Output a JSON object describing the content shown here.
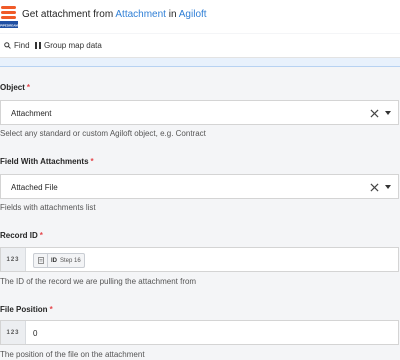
{
  "header": {
    "logo_text": "PIPEDREAM",
    "title_prefix": "Get attachment from ",
    "title_link_1": "Attachment",
    "title_mid": " in ",
    "title_link_2": "Agiloft"
  },
  "toolbar": {
    "find_label": "Find",
    "group_map_label": "Group map data"
  },
  "fields": {
    "object": {
      "label": "Object",
      "required_mark": "*",
      "value": "Attachment",
      "help": "Select any standard or custom Agiloft object, e.g. Contract"
    },
    "field_with_attachments": {
      "label": "Field With Attachments",
      "required_mark": "*",
      "value": "Attached File",
      "help": "Fields with attachments list"
    },
    "record_id": {
      "label": "Record ID",
      "required_mark": "*",
      "type_badge": "123",
      "pill_id": "ID",
      "pill_step": "Step 16",
      "help": "The ID of the record we are pulling the attachment from"
    },
    "file_position": {
      "label": "File Position",
      "required_mark": "*",
      "type_badge": "123",
      "value": "0",
      "help": "The position of the file on the attachment"
    }
  },
  "colors": {
    "accent_link": "#2f7fd6",
    "required": "#e5484d",
    "logo_orange": "#f05a28",
    "logo_blue": "#1f4fa3"
  }
}
